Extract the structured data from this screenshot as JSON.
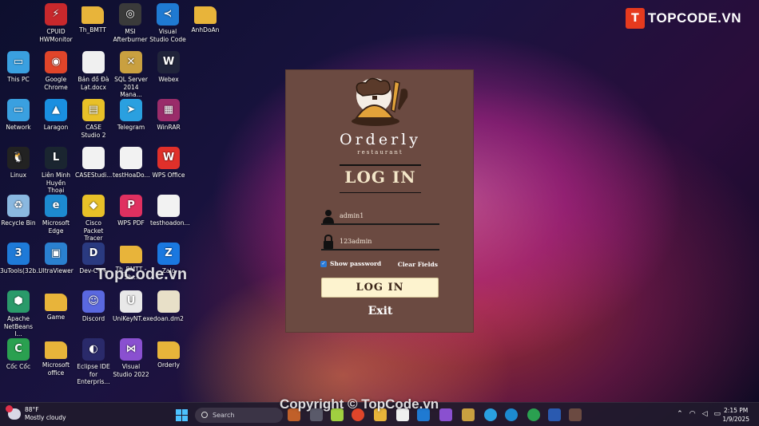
{
  "brand": {
    "mark": "T",
    "name": "TOPCODE.VN"
  },
  "watermarks": {
    "center": "TopCode.vn",
    "bottom": "Copyright © TopCode.vn"
  },
  "desktop_icons": [
    {
      "label": "CPUID HWMonitor",
      "icon": "cpuid-icon",
      "color": "#c8282c",
      "glyph": "⚡"
    },
    {
      "label": "Th_BMTT",
      "icon": "folder-icon",
      "color": "#e8b43a",
      "glyph": ""
    },
    {
      "label": "MSI Afterburner",
      "icon": "msi-icon",
      "color": "#3a3a3a",
      "glyph": "◎"
    },
    {
      "label": "Visual Studio Code",
      "icon": "vscode-icon",
      "color": "#1f7ad2",
      "glyph": "≺"
    },
    {
      "label": "AnhDoAn",
      "icon": "folder-icon",
      "color": "#e8b43a",
      "glyph": ""
    },
    {
      "label": "This PC",
      "icon": "pc-icon",
      "color": "#3aa0e0",
      "glyph": "▭"
    },
    {
      "label": "Google Chrome",
      "icon": "chrome-icon",
      "color": "#e0452a",
      "glyph": "◉"
    },
    {
      "label": "Bản đồ Đà Lạt.docx",
      "icon": "docx-icon",
      "color": "#f0f0f0",
      "glyph": ""
    },
    {
      "label": "SQL Server 2014 Mana...",
      "icon": "sql-icon",
      "color": "#c9a040",
      "glyph": "✕"
    },
    {
      "label": "Webex",
      "icon": "webex-icon",
      "color": "#20243a",
      "glyph": "W"
    },
    {
      "label": "Network",
      "icon": "network-icon",
      "color": "#3aa0e0",
      "glyph": "▭"
    },
    {
      "label": "Laragon",
      "icon": "laragon-icon",
      "color": "#1a8fe0",
      "glyph": "▲"
    },
    {
      "label": "CASE Studio 2",
      "icon": "case-icon",
      "color": "#e8c028",
      "glyph": "▤"
    },
    {
      "label": "Telegram",
      "icon": "telegram-icon",
      "color": "#2aa0e0",
      "glyph": "➤"
    },
    {
      "label": "WinRAR",
      "icon": "winrar-icon",
      "color": "#9a2c6a",
      "glyph": "▦"
    },
    {
      "label": "Linux",
      "icon": "linux-icon",
      "color": "#222222",
      "glyph": "🐧"
    },
    {
      "label": "Liên Minh Huyền Thoại",
      "icon": "lol-icon",
      "color": "#1a2530",
      "glyph": "L"
    },
    {
      "label": "CASEStudi...",
      "icon": "file-icon",
      "color": "#f2f2f2",
      "glyph": ""
    },
    {
      "label": "testHoaDo...",
      "icon": "chrome-file-icon",
      "color": "#f2f2f2",
      "glyph": ""
    },
    {
      "label": "WPS Office",
      "icon": "wps-icon",
      "color": "#e0302a",
      "glyph": "W"
    },
    {
      "label": "Recycle Bin",
      "icon": "recycle-bin-icon",
      "color": "#8ab8e0",
      "glyph": "♻"
    },
    {
      "label": "Microsoft Edge",
      "icon": "edge-icon",
      "color": "#1d8ad0",
      "glyph": "e"
    },
    {
      "label": "Cisco Packet Tracer",
      "icon": "cisco-icon",
      "color": "#e8c028",
      "glyph": "◆"
    },
    {
      "label": "WPS PDF",
      "icon": "wps-pdf-icon",
      "color": "#e03060",
      "glyph": "P"
    },
    {
      "label": "testhoadon...",
      "icon": "chrome-file-icon",
      "color": "#f2f2f2",
      "glyph": ""
    },
    {
      "label": "3uTools(32b...",
      "icon": "3utools-icon",
      "color": "#1e7ad8",
      "glyph": "3"
    },
    {
      "label": "UltraViewer",
      "icon": "ultraviewer-icon",
      "color": "#2a80d0",
      "glyph": "▣"
    },
    {
      "label": "Dev-C++",
      "icon": "devcpp-icon",
      "color": "#2a3a80",
      "glyph": "D"
    },
    {
      "label": "Th_BMTT - Sh...",
      "icon": "folder-icon",
      "color": "#e8b43a",
      "glyph": ""
    },
    {
      "label": "Zalo",
      "icon": "zalo-icon",
      "color": "#1a78e0",
      "glyph": "Z"
    },
    {
      "label": "Apache NetBeans I...",
      "icon": "netbeans-icon",
      "color": "#2a9a6a",
      "glyph": "⬢"
    },
    {
      "label": "Game",
      "icon": "folder-icon",
      "color": "#e8b43a",
      "glyph": ""
    },
    {
      "label": "Discord",
      "icon": "discord-icon",
      "color": "#5a68e0",
      "glyph": "☺"
    },
    {
      "label": "UniKeyNT.exe",
      "icon": "unikey-icon",
      "color": "#e8e8e8",
      "glyph": "U"
    },
    {
      "label": "doan.dm2",
      "icon": "dm2-file-icon",
      "color": "#e8e0c8",
      "glyph": ""
    },
    {
      "label": "Cốc Cốc",
      "icon": "coccoc-icon",
      "color": "#2aa050",
      "glyph": "C"
    },
    {
      "label": "Microsoft office",
      "icon": "folder-icon",
      "color": "#e8b43a",
      "glyph": ""
    },
    {
      "label": "Eclipse IDE for Enterpris...",
      "icon": "eclipse-icon",
      "color": "#2a2a6a",
      "glyph": "◐"
    },
    {
      "label": "Visual Studio 2022",
      "icon": "vs2022-icon",
      "color": "#8a50d0",
      "glyph": "⋈"
    },
    {
      "label": "Orderly",
      "icon": "folder-icon",
      "color": "#e8b43a",
      "glyph": ""
    }
  ],
  "login": {
    "app_name": "Orderly",
    "app_subtitle": "restaurant",
    "heading": "LOG IN",
    "username_value": "admin1",
    "password_value": "123admin",
    "show_password_label": "Show password",
    "show_password_checked": true,
    "clear_label": "Clear Fields",
    "login_button": "LOG IN",
    "exit_label": "Exit"
  },
  "taskbar": {
    "weather_temp": "88°F",
    "weather_desc": "Mostly cloudy",
    "search_placeholder": "Search",
    "time": "2:15 PM",
    "date": "1/9/2025"
  }
}
